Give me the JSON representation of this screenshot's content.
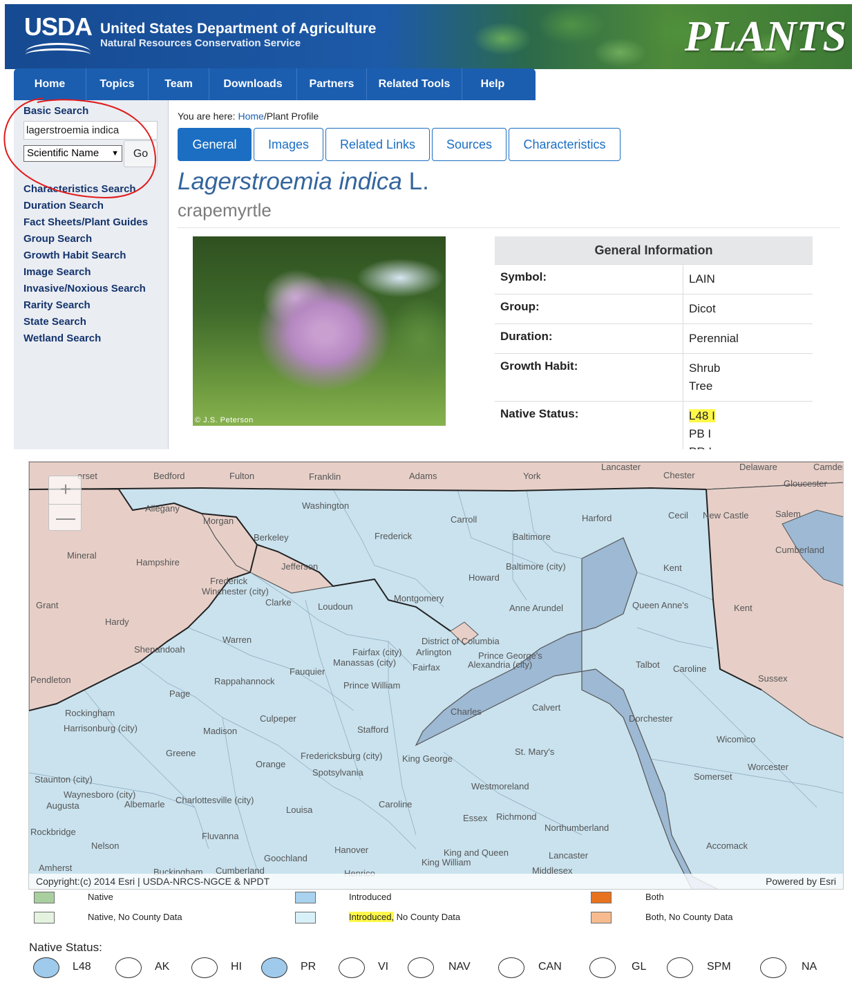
{
  "header": {
    "logo_text": "USDA",
    "agency_title": "United States Department of Agriculture",
    "agency_subtitle": "Natural Resources Conservation Service",
    "site_logo": "PLANTS"
  },
  "nav": {
    "items": [
      "Home",
      "Topics",
      "Team",
      "Downloads",
      "Partners",
      "Related Tools",
      "Help"
    ]
  },
  "sidebar": {
    "basic_search_heading": "Basic Search",
    "search_value": "lagerstroemia indica",
    "search_type": "Scientific Name",
    "go_label": "Go",
    "links": [
      "Characteristics Search",
      "Duration Search",
      "Fact Sheets/Plant Guides",
      "Group Search",
      "Growth Habit Search",
      "Image Search",
      "Invasive/Noxious Search",
      "Rarity Search",
      "State Search",
      "Wetland Search"
    ]
  },
  "breadcrumb": {
    "prefix": "You are here: ",
    "home": "Home",
    "current": "/Plant Profile"
  },
  "tabs": [
    "General",
    "Images",
    "Related Links",
    "Sources",
    "Characteristics"
  ],
  "plant": {
    "scientific_name": "Lagerstroemia indica",
    "author": "L.",
    "common_name": "crapemyrtle",
    "photo_credit": "© J.S. Peterson"
  },
  "general_info": {
    "heading": "General Information",
    "symbol_label": "Symbol:",
    "symbol_value": "LAIN",
    "group_label": "Group:",
    "group_value": "Dicot",
    "duration_label": "Duration:",
    "duration_value": "Perennial",
    "growth_label": "Growth Habit:",
    "growth_value_1": "Shrub",
    "growth_value_2": "Tree",
    "native_label": "Native Status:",
    "native_value_1": "L48 I",
    "native_value_2": "PB I",
    "native_value_3": "PR I"
  },
  "map": {
    "zoom_in": "+",
    "zoom_out": "—",
    "attribution": "Copyright:(c) 2014 Esri | USDA-NRCS-NGCE & NPDT",
    "powered_by": "Powered by Esri",
    "colors": {
      "introduced": "#c9e2ee",
      "no_data": "#e7cfc8",
      "water": "#9db9d3"
    },
    "labels": {
      "l1": "erset",
      "l2": "Bedford",
      "l3": "Fulton",
      "l4": "Franklin",
      "l5": "Adams",
      "l6": "York",
      "l7": "Lancaster",
      "l8": "Chester",
      "l9": "Delaware",
      "l10": "Camden",
      "l11": "Gloucester",
      "l12": "Allegany",
      "l13": "Washington",
      "l14": "Morgan",
      "l15": "Carroll",
      "l16": "Harford",
      "l17": "Cecil",
      "l18": "New Castle",
      "l19": "Salem",
      "l20": "Berkeley",
      "l21": "Frederick",
      "l22": "Baltimore",
      "l23": "Cumberland",
      "l24": "Mineral",
      "l25": "Hampshire",
      "l26": "Jefferson",
      "l27": "Baltimore (city)",
      "l28": "Kent",
      "l29": "Howard",
      "l30": "Frederick",
      "l31": "Winchester (city)",
      "l32": "Clarke",
      "l33": "Loudoun",
      "l34": "Montgomery",
      "l35": "Anne Arundel",
      "l36": "Queen Anne's",
      "l37": "Kent",
      "l38": "Grant",
      "l39": "Hardy",
      "l40": "Warren",
      "l41": "District of Columbia",
      "l42": "Shenandoah",
      "l43": "Fairfax (city)",
      "l44": "Arlington",
      "l45": "Prince George's",
      "l46": "Manassas (city)",
      "l47": "Fairfax",
      "l48": "Alexandria (city)",
      "l49": "Talbot",
      "l50": "Caroline",
      "l51": "Fauquier",
      "l52": "Pendleton",
      "l53": "Rappahannock",
      "l54": "Prince William",
      "l55": "Sussex",
      "l56": "Page",
      "l57": "Charles",
      "l58": "Calvert",
      "l59": "Rockingham",
      "l60": "Culpeper",
      "l61": "Dorchester",
      "l62": "Harrisonburg (city)",
      "l63": "Madison",
      "l64": "Stafford",
      "l65": "Wicomico",
      "l66": "Greene",
      "l67": "Fredericksburg (city)",
      "l68": "King George",
      "l69": "St. Mary's",
      "l70": "Orange",
      "l71": "Worcester",
      "l72": "Spotsylvania",
      "l73": "Somerset",
      "l74": "Staunton (city)",
      "l75": "Westmoreland",
      "l76": "Waynesboro (city)",
      "l77": "Augusta",
      "l78": "Albemarle",
      "l79": "Charlottesville (city)",
      "l80": "Caroline",
      "l81": "Louisa",
      "l82": "Essex",
      "l83": "Richmond",
      "l84": "Northumberland",
      "l85": "Rockbridge",
      "l86": "Fluvanna",
      "l87": "Accomack",
      "l88": "Nelson",
      "l89": "Hanover",
      "l90": "King and Queen",
      "l91": "Lancaster",
      "l92": "Goochland",
      "l93": "King William",
      "l94": "Amherst",
      "l95": "Buckingham",
      "l96": "Cumberland",
      "l97": "Henrico",
      "l98": "Middlesex"
    }
  },
  "legend": {
    "items": [
      {
        "label": "Native",
        "color": "#a9cf9f"
      },
      {
        "label": "Introduced",
        "color": "#a8d2ee"
      },
      {
        "label": "Both",
        "color": "#e8731e"
      },
      {
        "label": "Native, No County Data",
        "color": "#e3f3e0"
      },
      {
        "label_hl": "Introduced,",
        "label_rest": " No County Data",
        "color": "#d8f0f8"
      },
      {
        "label": "Both, No County Data",
        "color": "#f6bb8e"
      }
    ]
  },
  "native_status": {
    "title": "Native Status:",
    "options": [
      {
        "label": "L48",
        "checked": true
      },
      {
        "label": "AK",
        "checked": false
      },
      {
        "label": "HI",
        "checked": false
      },
      {
        "label": "PR",
        "checked": true
      },
      {
        "label": "VI",
        "checked": false
      },
      {
        "label": "NAV",
        "checked": false
      },
      {
        "label": "CAN",
        "checked": false
      },
      {
        "label": "GL",
        "checked": false
      },
      {
        "label": "SPM",
        "checked": false
      },
      {
        "label": "NA",
        "checked": false
      }
    ]
  }
}
